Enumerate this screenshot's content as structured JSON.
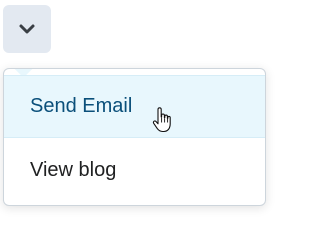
{
  "toggle": {
    "icon": "chevron-down-icon"
  },
  "menu": {
    "items": [
      {
        "label": "Send Email",
        "state": "hover"
      },
      {
        "label": "View blog"
      }
    ]
  },
  "cursor": {
    "icon": "hand-pointer-icon"
  },
  "colors": {
    "toggle_bg": "#e3e9f1",
    "hover_bg": "#e8f7fd",
    "hover_text": "#0a4f7a",
    "text": "#202122",
    "border": "#cdd5dc"
  }
}
